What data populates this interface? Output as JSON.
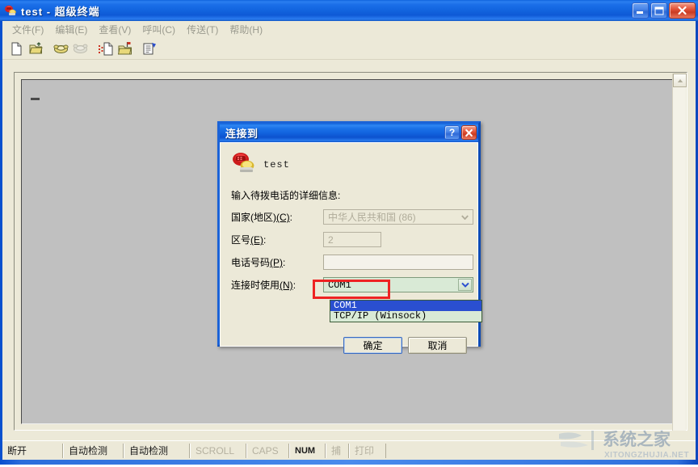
{
  "window": {
    "title": "test - 超级终端",
    "icon": "phone-icon",
    "buttons": {
      "minimize": "minimize-button",
      "maximize": "maximize-button",
      "close": "close-button"
    }
  },
  "menubar": {
    "items": [
      {
        "label": "文件",
        "accel": "(F)"
      },
      {
        "label": "编辑",
        "accel": "(E)"
      },
      {
        "label": "查看",
        "accel": "(V)"
      },
      {
        "label": "呼叫",
        "accel": "(C)"
      },
      {
        "label": "传送",
        "accel": "(T)"
      },
      {
        "label": "帮助",
        "accel": "(H)"
      }
    ]
  },
  "toolbar": {
    "buttons": [
      "new-connection-icon",
      "open-folder-icon",
      "call-icon",
      "disconnect-icon",
      "send-file-icon",
      "receive-file-icon",
      "properties-icon"
    ]
  },
  "terminal": {
    "content": "",
    "caret": "-"
  },
  "statusbar": {
    "cells": [
      {
        "text": "断开",
        "state": "label"
      },
      {
        "text": "自动检测",
        "state": "label"
      },
      {
        "text": "自动检测",
        "state": "label"
      },
      {
        "text": "SCROLL",
        "state": "dim"
      },
      {
        "text": "CAPS",
        "state": "dim"
      },
      {
        "text": "NUM",
        "state": "on"
      },
      {
        "text": "捕",
        "state": "dim"
      },
      {
        "text": "打印",
        "state": "dim"
      }
    ]
  },
  "watermark": {
    "cn": "系统之家",
    "en": "XITONGZHUJIA.NET"
  },
  "dialog": {
    "title": "连接到",
    "help_label": "?",
    "close_label": "✕",
    "connection_name": "test",
    "connection_icon": "phone-icon",
    "prompt": "输入待拨电话的详细信息:",
    "fields": [
      {
        "label": "国家(地区)",
        "accel": "(C)",
        "suffix": ":",
        "type": "combo",
        "value": "中华人民共和国  (86)",
        "enabled": false
      },
      {
        "label": "区号",
        "accel": "(E)",
        "suffix": ":",
        "type": "text",
        "value": "2",
        "enabled": false
      },
      {
        "label": "电话号码",
        "accel": "(P)",
        "suffix": ":",
        "type": "text",
        "value": "",
        "enabled": true
      },
      {
        "label": "连接时使用",
        "accel": "(N)",
        "suffix": ":",
        "type": "combo-open",
        "value": "COM1",
        "enabled": true
      }
    ],
    "dropdown": {
      "open": true,
      "options": [
        "COM1",
        "TCP/IP (Winsock)"
      ],
      "selected_index": 0
    },
    "buttons": {
      "ok": "确定",
      "cancel": "取消"
    },
    "annotation": {
      "type": "red-highlight-box",
      "color": "#ee2222",
      "target": "connect-using-combo"
    }
  },
  "colors": {
    "title_blue": "#1366e0",
    "frame_blue": "#2b6ddb",
    "face": "#ece9d8",
    "terminal_bg": "#c0c0c0",
    "combo_active_bg": "#d9ead6",
    "selection_blue": "#2a4fd0",
    "annotation_red": "#ee2222"
  }
}
